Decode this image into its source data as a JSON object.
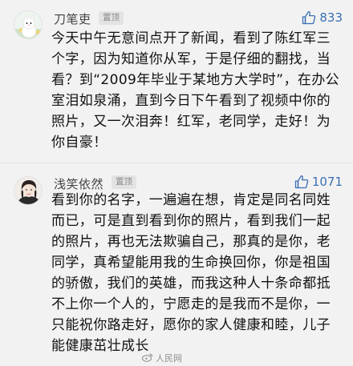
{
  "comments": [
    {
      "username": "刀笔吏",
      "pinned_label": "置顶",
      "like_count": "833",
      "text": "今天中午无意间点开了新闻，看到了陈红军三个字，因为知道你从军，于是仔细的翻找，当看？到“2009年毕业于某地方大学时”，在办公室泪如泉涌，直到今日下午看到了视频中你的照片，又一次泪奔！红军，老同学，走好！为你自豪！"
    },
    {
      "username": "浅笑依然",
      "pinned_label": "置顶",
      "like_count": "1071",
      "text": "看到你的名字，一遍遍在想，肯定是同名同姓而已，可是直到看到你的照片，看到我们一起的照片，再也无法欺骗自己，那真的是你，老同学，真希望能用我的生命换回你，你是祖国的骄傲，我们的英雄，而我这种人十条命都抵不上你一个人的，宁愿走的是我而不是你，一只能祝你路走好，愿你的家人健康和睦，儿子能健康茁壮成长"
    }
  ],
  "watermark": {
    "text": "人民网",
    "icon": "weibo-icon"
  },
  "colors": {
    "background": "#f2f2f2",
    "like_blue": "#3a6fb5",
    "badge_bg": "#e3e3e3"
  },
  "icons": {
    "like": "thumbs-up-icon"
  }
}
